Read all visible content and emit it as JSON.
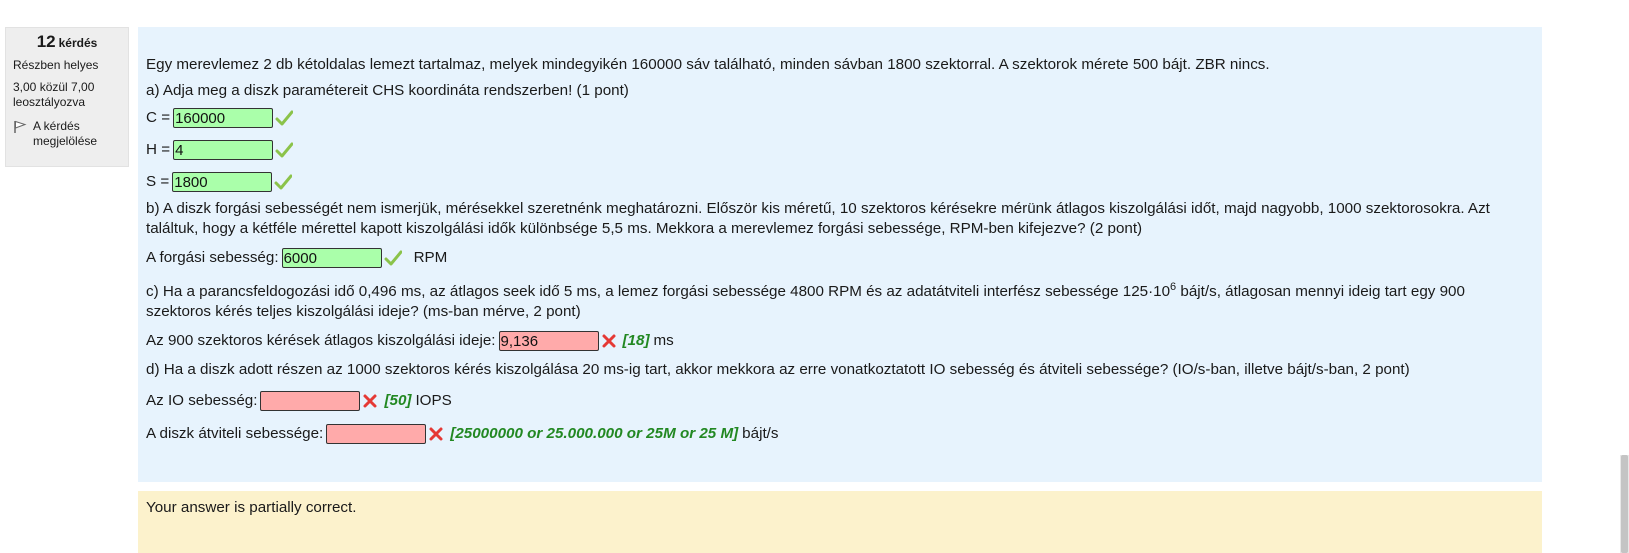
{
  "question_info": {
    "number": "12",
    "number_label": "kérdés",
    "state": "Részben helyes",
    "grade": "3,00 közül 7,00 leosztályozva",
    "flag_label": "A kérdés megjelölése"
  },
  "question": {
    "intro": "Egy merevlemez 2 db kétoldalas lemezt tartalmaz, melyek mindegyikén 160000 sáv található, minden sávban 1800 szektorral. A szektorok mérete 500 bájt. ZBR nincs.",
    "part_a": {
      "text": "a) Adja meg a diszk paramétereit CHS koordináta rendszerben! (1 pont)",
      "c_label": "C =",
      "c_value": "160000",
      "h_label": "H =",
      "h_value": "4",
      "s_label": "S =",
      "s_value": "1800"
    },
    "part_b": {
      "text": "b) A diszk forgási sebességét nem ismerjük, mérésekkel szeretnénk meghatározni. Először kis méretű, 10 szektoros kérésekre mérünk átlagos kiszolgálási időt, majd nagyobb, 1000 szektorosokra. Azt találtuk, hogy a kétféle mérettel kapott kiszolgálási idők különbsége 5,5 ms. Mekkora a merevlemez forgási sebessége, RPM-ben kifejezve? (2 pont)",
      "label": "A forgási sebesség:",
      "value": "6000",
      "unit": "RPM"
    },
    "part_c": {
      "text_before": "c) Ha a parancsfeldogozási idő 0,496 ms, az átlagos seek idő 5 ms, a lemez forgási sebessége 4800 RPM és az adatátviteli interfész sebessége 125·10",
      "exponent": "6",
      "text_after": " bájt/s, átlagosan mennyi ideig tart egy 900 szektoros kérés teljes kiszolgálási ideje? (ms-ban mérve, 2 pont)",
      "label": "Az 900 szektoros kérések átlagos kiszolgálási ideje:",
      "value": "9,136",
      "right_answer": "[18]",
      "unit": "ms"
    },
    "part_d": {
      "text": "d) Ha a diszk adott részen az 1000 szektoros kérés kiszolgálása 20 ms-ig tart, akkor mekkora az erre vonatkoztatott IO sebesség és átviteli sebessége? (IO/s-ban, illetve bájt/s-ban, 2 pont)",
      "io_label": "Az IO sebesség:",
      "io_value": "",
      "io_right_answer": "[50]",
      "io_unit": "IOPS",
      "tp_label": "A diszk átviteli sebessége:",
      "tp_value": "",
      "tp_right_answer": "[25000000 or 25.000.000 or 25M or 25 M]",
      "tp_unit": "bájt/s"
    }
  },
  "feedback": "Your answer is partially correct.",
  "icons": {
    "correct": "check-icon",
    "incorrect": "cross-icon",
    "flag": "flag-icon"
  },
  "colors": {
    "content_bg": "#e7f3fd",
    "correct_field": "#aaffaa",
    "incorrect_field": "#ffaaaa",
    "right_answer": "#228822",
    "feedback_bg": "#fcf2cc",
    "check": "#8bc34a",
    "cross": "#e53935"
  }
}
